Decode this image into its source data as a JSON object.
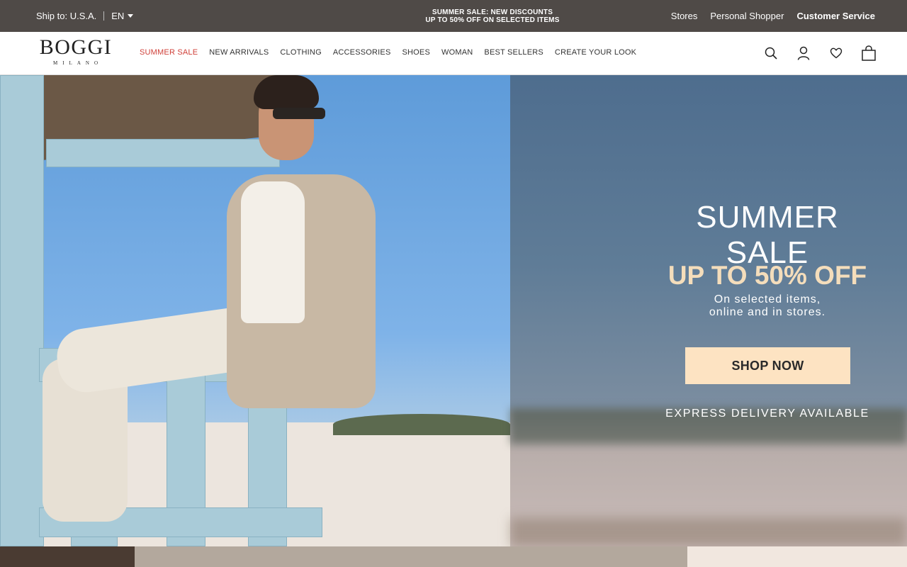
{
  "topbar": {
    "ship_to": "Ship to: U.S.A.",
    "language": "EN",
    "promo_line1": "SUMMER SALE: NEW DISCOUNTS",
    "promo_line2": "UP TO 50% OFF ON SELECTED ITEMS",
    "links": [
      "Stores",
      "Personal Shopper",
      "Customer Service"
    ]
  },
  "header": {
    "logo_main": "BOGGI",
    "logo_sub": "MILANO",
    "nav": [
      "SUMMER SALE",
      "NEW ARRIVALS",
      "CLOTHING",
      "ACCESSORIES",
      "SHOES",
      "WOMAN",
      "BEST SELLERS",
      "CREATE YOUR LOOK"
    ],
    "icons": [
      "search-icon",
      "account-icon",
      "wishlist-heart-icon",
      "shopping-bag-icon"
    ]
  },
  "hero": {
    "title": "SUMMER SALE",
    "offer": "UP TO 50% OFF",
    "description_line1": "On selected items,",
    "description_line2": "online and in stores.",
    "cta": "SHOP NOW",
    "express": "EXPRESS DELIVERY AVAILABLE"
  },
  "colors": {
    "topbar_bg": "#4f4a47",
    "sale_red": "#d0413a",
    "offer_text": "#f4ddbb",
    "cta_bg": "#fde3c2"
  }
}
